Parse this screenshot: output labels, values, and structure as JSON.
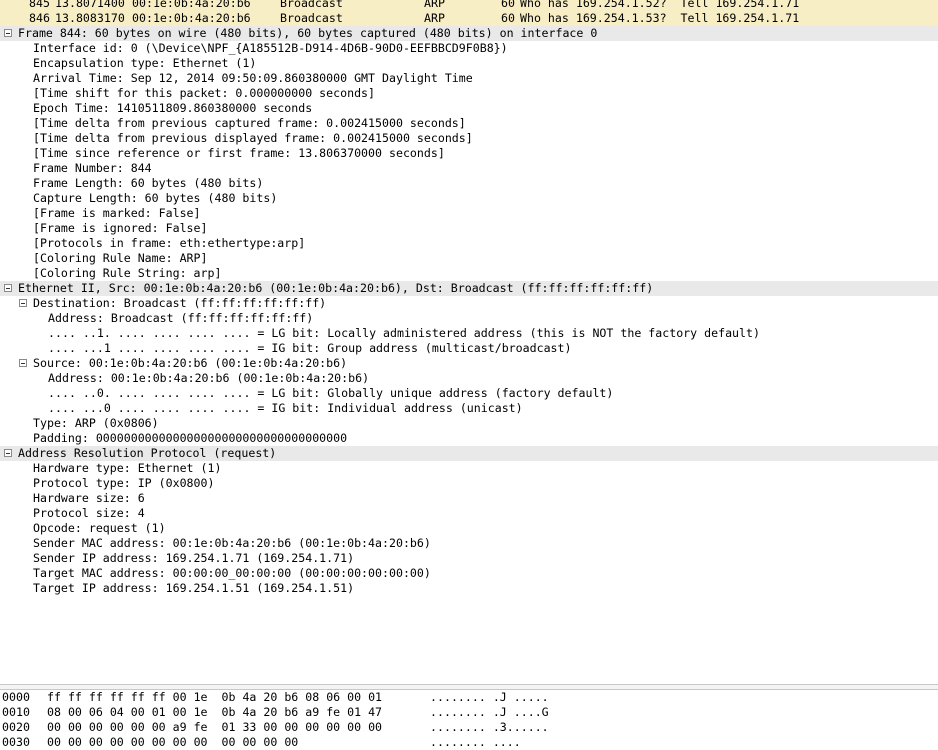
{
  "packet_list": [
    {
      "no": "845",
      "time": "13.8071400",
      "src": "00:1e:0b:4a:20:b6",
      "dst": "Broadcast",
      "proto": "ARP",
      "len": "60",
      "info": "Who has 169.254.1.52?  Tell 169.254.1.71"
    },
    {
      "no": "846",
      "time": "13.8083170",
      "src": "00:1e:0b:4a:20:b6",
      "dst": "Broadcast",
      "proto": "ARP",
      "len": "60",
      "info": "Who has 169.254.1.53?  Tell 169.254.1.71"
    }
  ],
  "details": [
    {
      "text": "Frame 844: 60 bytes on wire (480 bits), 60 bytes captured (480 bits) on interface 0",
      "level": 0,
      "toggle": true,
      "header": true
    },
    {
      "text": "Interface id: 0 (\\Device\\NPF_{A185512B-D914-4D6B-90D0-EEFBBCD9F0B8})",
      "level": 1
    },
    {
      "text": "Encapsulation type: Ethernet (1)",
      "level": 1
    },
    {
      "text": "Arrival Time: Sep 12, 2014 09:50:09.860380000 GMT Daylight Time",
      "level": 1
    },
    {
      "text": "[Time shift for this packet: 0.000000000 seconds]",
      "level": 1
    },
    {
      "text": "Epoch Time: 1410511809.860380000 seconds",
      "level": 1
    },
    {
      "text": "[Time delta from previous captured frame: 0.002415000 seconds]",
      "level": 1
    },
    {
      "text": "[Time delta from previous displayed frame: 0.002415000 seconds]",
      "level": 1
    },
    {
      "text": "[Time since reference or first frame: 13.806370000 seconds]",
      "level": 1
    },
    {
      "text": "Frame Number: 844",
      "level": 1
    },
    {
      "text": "Frame Length: 60 bytes (480 bits)",
      "level": 1
    },
    {
      "text": "Capture Length: 60 bytes (480 bits)",
      "level": 1
    },
    {
      "text": "[Frame is marked: False]",
      "level": 1
    },
    {
      "text": "[Frame is ignored: False]",
      "level": 1
    },
    {
      "text": "[Protocols in frame: eth:ethertype:arp]",
      "level": 1
    },
    {
      "text": "[Coloring Rule Name: ARP]",
      "level": 1
    },
    {
      "text": "[Coloring Rule String: arp]",
      "level": 1
    },
    {
      "text": "Ethernet II, Src: 00:1e:0b:4a:20:b6 (00:1e:0b:4a:20:b6), Dst: Broadcast (ff:ff:ff:ff:ff:ff)",
      "level": 0,
      "toggle": true,
      "header": true
    },
    {
      "text": "Destination: Broadcast (ff:ff:ff:ff:ff:ff)",
      "level": 1,
      "toggle": true
    },
    {
      "text": "Address: Broadcast (ff:ff:ff:ff:ff:ff)",
      "level": 2
    },
    {
      "text": ".... ..1. .... .... .... .... = LG bit: Locally administered address (this is NOT the factory default)",
      "level": 2
    },
    {
      "text": ".... ...1 .... .... .... .... = IG bit: Group address (multicast/broadcast)",
      "level": 2
    },
    {
      "text": "Source: 00:1e:0b:4a:20:b6 (00:1e:0b:4a:20:b6)",
      "level": 1,
      "toggle": true
    },
    {
      "text": "Address: 00:1e:0b:4a:20:b6 (00:1e:0b:4a:20:b6)",
      "level": 2
    },
    {
      "text": ".... ..0. .... .... .... .... = LG bit: Globally unique address (factory default)",
      "level": 2
    },
    {
      "text": ".... ...0 .... .... .... .... = IG bit: Individual address (unicast)",
      "level": 2
    },
    {
      "text": "Type: ARP (0x0806)",
      "level": 1
    },
    {
      "text": "Padding: 000000000000000000000000000000000000",
      "level": 1
    },
    {
      "text": "Address Resolution Protocol (request)",
      "level": 0,
      "toggle": true,
      "header": true
    },
    {
      "text": "Hardware type: Ethernet (1)",
      "level": 1
    },
    {
      "text": "Protocol type: IP (0x0800)",
      "level": 1
    },
    {
      "text": "Hardware size: 6",
      "level": 1
    },
    {
      "text": "Protocol size: 4",
      "level": 1
    },
    {
      "text": "Opcode: request (1)",
      "level": 1
    },
    {
      "text": "Sender MAC address: 00:1e:0b:4a:20:b6 (00:1e:0b:4a:20:b6)",
      "level": 1
    },
    {
      "text": "Sender IP address: 169.254.1.71 (169.254.1.71)",
      "level": 1
    },
    {
      "text": "Target MAC address: 00:00:00_00:00:00 (00:00:00:00:00:00)",
      "level": 1
    },
    {
      "text": "Target IP address: 169.254.1.51 (169.254.1.51)",
      "level": 1
    }
  ],
  "bytes": [
    {
      "offset": "0000",
      "hex": "ff ff ff ff ff ff 00 1e  0b 4a 20 b6 08 06 00 01",
      "ascii": "........ .J ....."
    },
    {
      "offset": "0010",
      "hex": "08 00 06 04 00 01 00 1e  0b 4a 20 b6 a9 fe 01 47",
      "ascii": "........ .J ....G"
    },
    {
      "offset": "0020",
      "hex": "00 00 00 00 00 00 a9 fe  01 33 00 00 00 00 00 00",
      "ascii": "........ .3......"
    },
    {
      "offset": "0030",
      "hex": "00 00 00 00 00 00 00 00  00 00 00 00",
      "ascii": "........ ...."
    }
  ],
  "colors": {
    "packet_row_bg": "#f8eec6",
    "section_header_bg": "#e9e9e9"
  }
}
